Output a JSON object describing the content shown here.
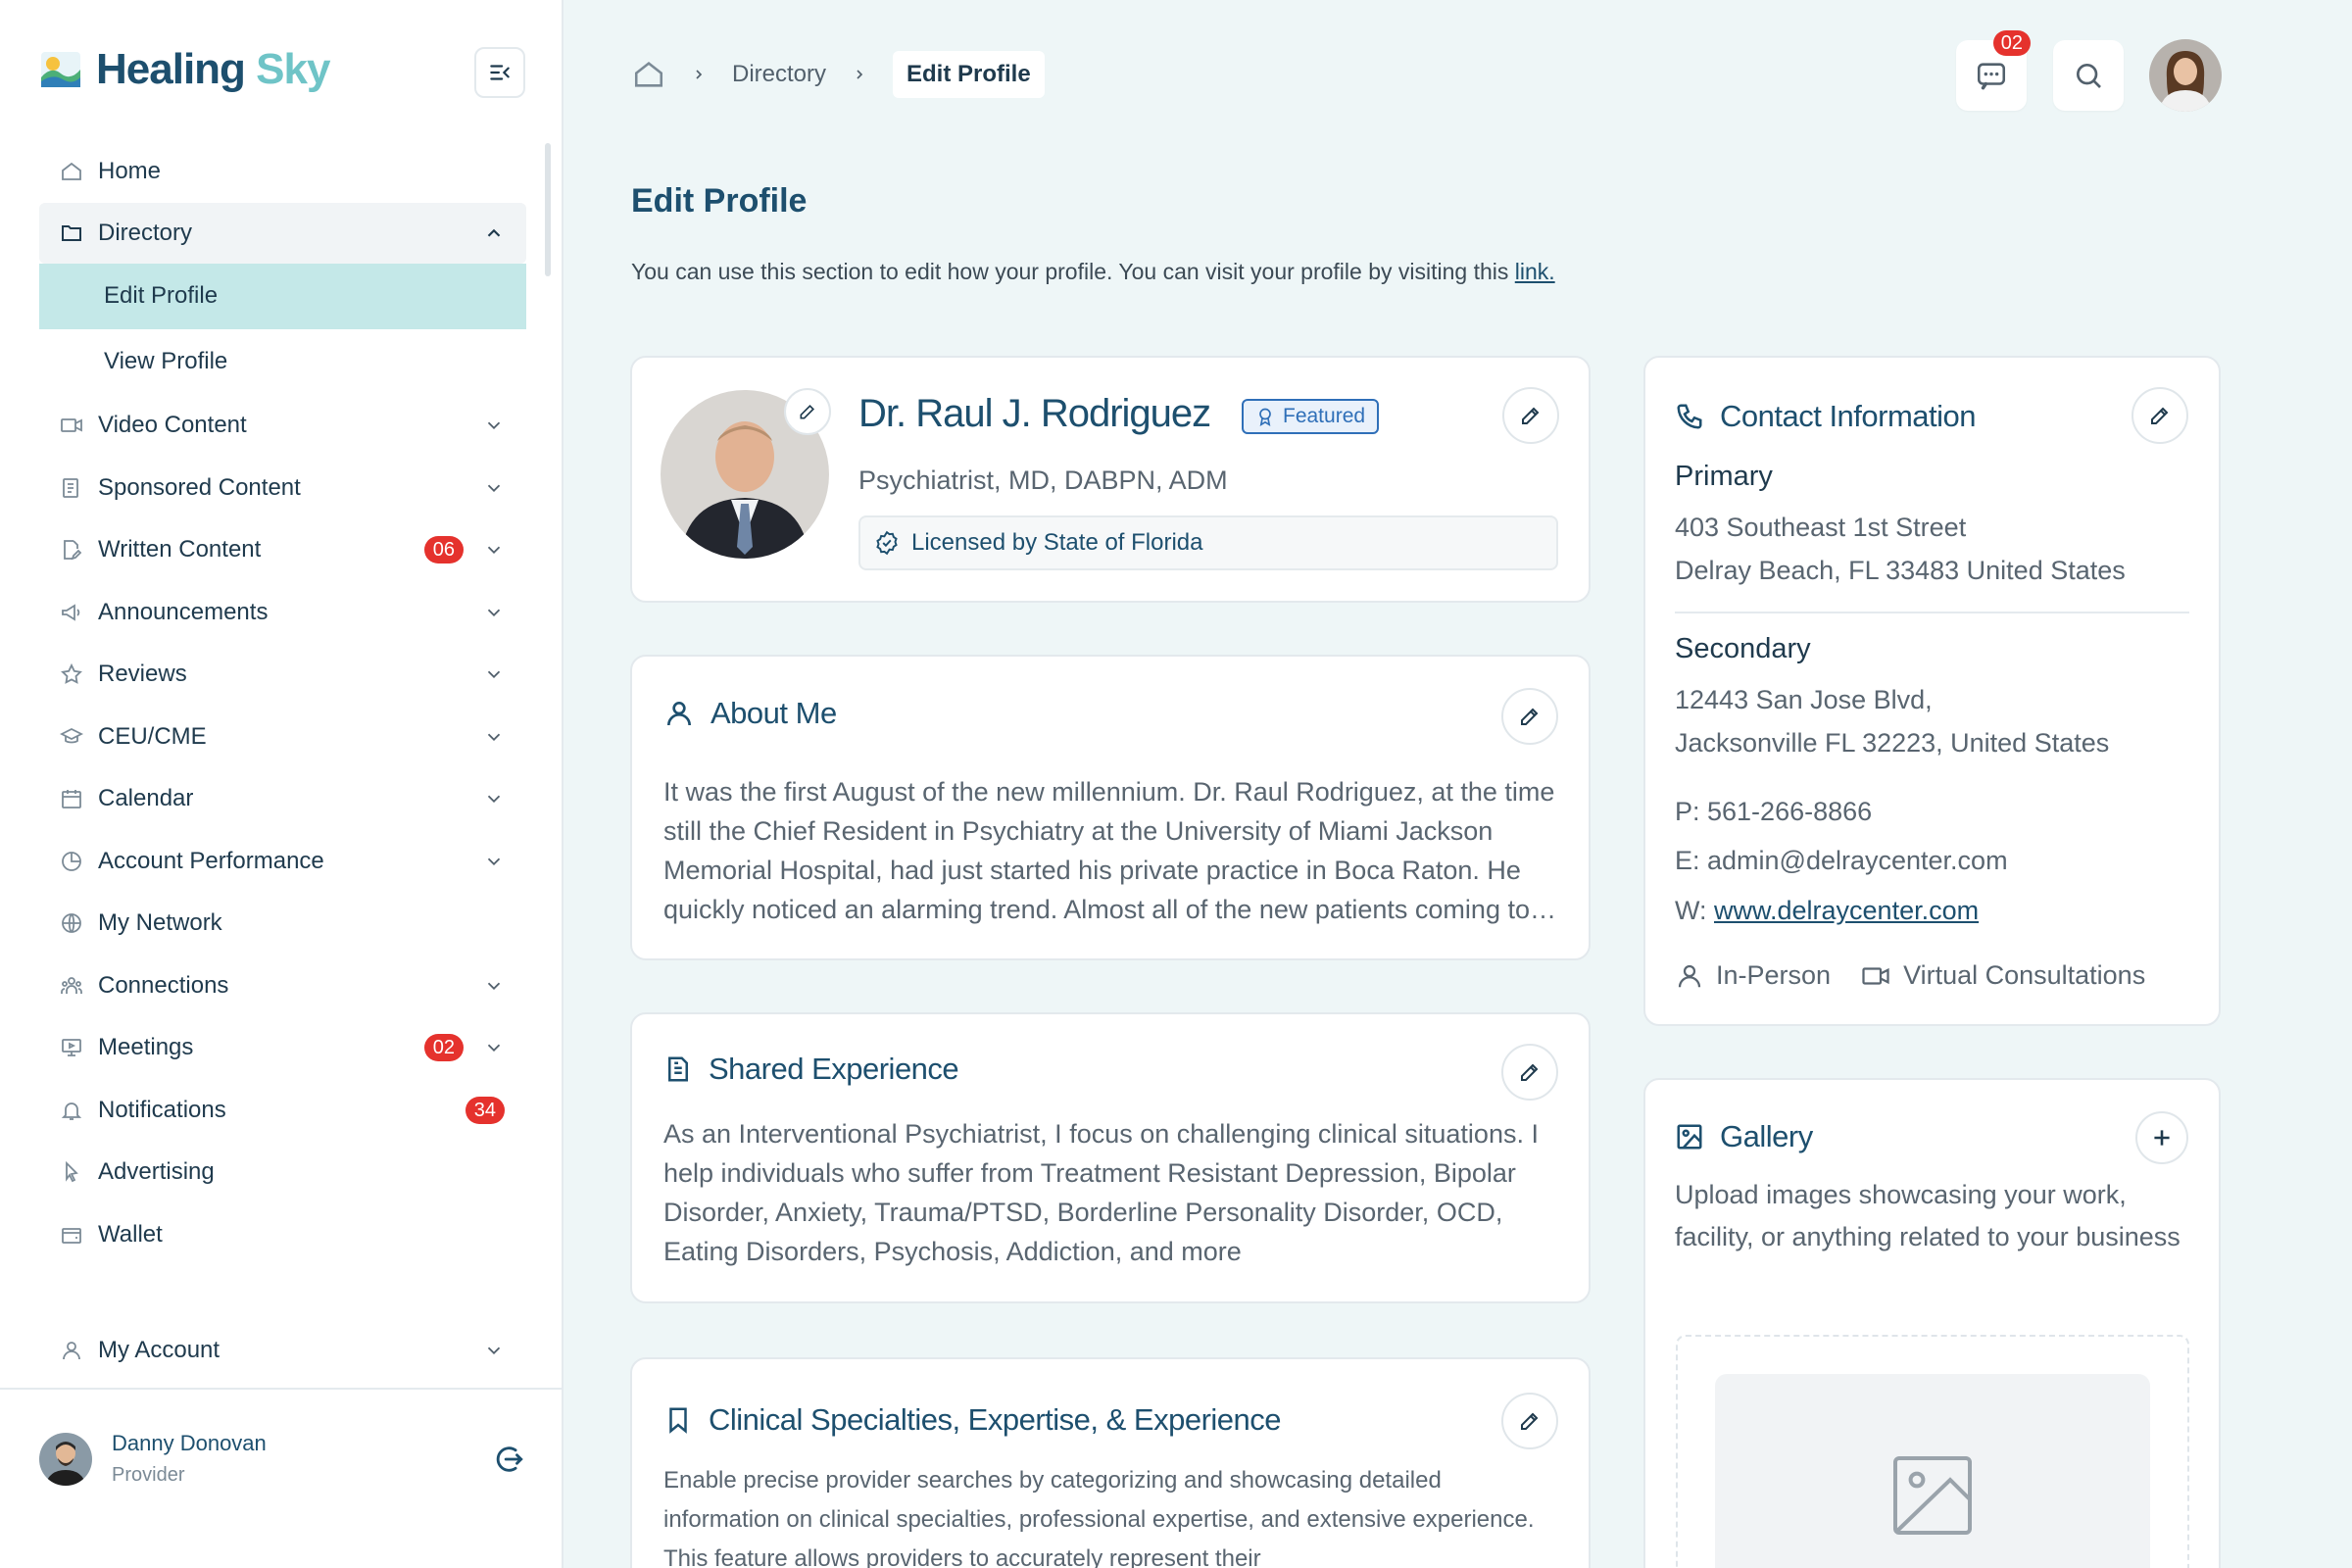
{
  "brand": {
    "name_part1": "Healing",
    "name_part2": "Sky"
  },
  "sidebar": {
    "items": [
      {
        "label": "Home"
      },
      {
        "label": "Directory"
      },
      {
        "label": "Edit Profile"
      },
      {
        "label": "View Profile"
      },
      {
        "label": "Video Content"
      },
      {
        "label": "Sponsored Content"
      },
      {
        "label": "Written Content",
        "badge": "06"
      },
      {
        "label": "Announcements"
      },
      {
        "label": "Reviews"
      },
      {
        "label": "CEU/CME"
      },
      {
        "label": "Calendar"
      },
      {
        "label": "Account Performance"
      },
      {
        "label": "My Network"
      },
      {
        "label": "Connections"
      },
      {
        "label": "Meetings",
        "badge": "02"
      },
      {
        "label": "Notifications",
        "badge": "34"
      },
      {
        "label": "Advertising"
      },
      {
        "label": "Wallet"
      }
    ],
    "account_label": "My Account",
    "user": {
      "name": "Danny Donovan",
      "role": "Provider"
    }
  },
  "breadcrumb": {
    "parent": "Directory",
    "current": "Edit Profile"
  },
  "header": {
    "messages_badge": "02"
  },
  "page": {
    "title": "Edit Profile",
    "description": "You can use this section to edit how your profile. You can visit your profile by visiting this",
    "link_text": "link."
  },
  "profile": {
    "name": "Dr. Raul J. Rodriguez",
    "featured_label": "Featured",
    "credentials": "Psychiatrist, MD, DABPN, ADM",
    "license": "Licensed by State of Florida"
  },
  "about": {
    "title": "About Me",
    "text": "It was the first August of the new millennium. Dr. Raul Rodriguez, at the time still the Chief Resident in Psychiatry at the University of Miami Jackson Memorial Hospital, had just started his private practice in Boca Raton. He quickly noticed an alarming trend. Almost all of the new patients coming to his practice"
  },
  "shared": {
    "title": "Shared Experience",
    "text": "As an Interventional Psychiatrist, I focus on challenging clinical situations. I help individuals who suffer from Treatment Resistant Depression, Bipolar Disorder, Anxiety, Trauma/PTSD, Borderline Personality Disorder, OCD, Eating Disorders, Psychosis, Addiction, and more"
  },
  "specialties": {
    "title": "Clinical Specialties, Expertise, & Experience",
    "text": "Enable precise provider searches by categorizing and showcasing detailed information on clinical specialties, professional expertise, and extensive experience. This feature allows providers to accurately represent their"
  },
  "contact": {
    "title": "Contact Information",
    "primary_label": "Primary",
    "primary_line1": "403 Southeast 1st Street",
    "primary_line2": "Delray Beach, FL 33483 United States",
    "secondary_label": "Secondary",
    "secondary_line1": "12443 San Jose Blvd,",
    "secondary_line2": "Jacksonville FL 32223, United States",
    "phone": "P: 561-266-8866",
    "email": "E: admin@delraycenter.com",
    "web_prefix": "W: ",
    "web_link": "www.delraycenter.com",
    "mode_in_person": "In-Person",
    "mode_virtual": "Virtual Consultations"
  },
  "gallery": {
    "title": "Gallery",
    "description": "Upload images showcasing your work, facility, or anything related to your business"
  },
  "colors": {
    "brand_dark": "#1d4f6e",
    "brand_teal": "#6fc4c7",
    "active_bg": "#c4e8e8",
    "badge_red": "#e5322d",
    "page_bg": "#eef6f7"
  },
  "icons": {
    "nav": [
      "home-icon",
      "folder-icon",
      "video-icon",
      "document-icon",
      "edit-document-icon",
      "megaphone-icon",
      "star-icon",
      "graduation-cap-icon",
      "calendar-icon",
      "pie-chart-icon",
      "globe-icon",
      "people-icon",
      "presentation-icon",
      "bell-icon",
      "cursor-icon",
      "wallet-icon",
      "user-icon"
    ]
  }
}
